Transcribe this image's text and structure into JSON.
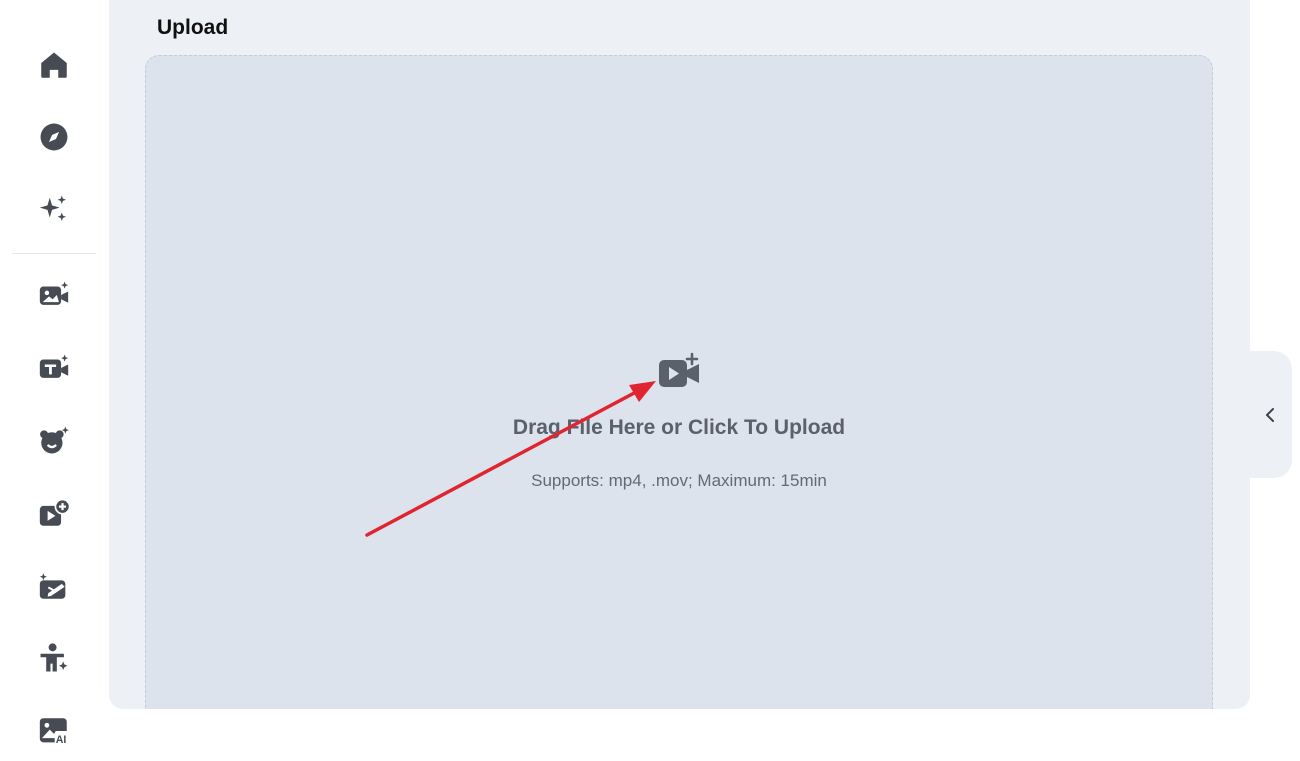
{
  "sidebar": {
    "items": [
      {
        "name": "home-icon"
      },
      {
        "name": "compass-icon"
      },
      {
        "name": "sparkles-icon"
      },
      {
        "name": "image-to-video-icon"
      },
      {
        "name": "text-to-video-icon"
      },
      {
        "name": "avatar-icon"
      },
      {
        "name": "add-video-icon"
      },
      {
        "name": "video-edit-icon"
      },
      {
        "name": "person-magic-icon"
      },
      {
        "name": "ai-image-icon"
      }
    ]
  },
  "upload": {
    "title": "Upload",
    "main_text": "Drag File Here or Click To Upload",
    "sub_text": "Supports: mp4, .mov; Maximum: 15min",
    "icon": "video-plus-icon"
  },
  "colors": {
    "panel_bg": "#edf0f5",
    "dropzone_bg": "#dde3ec",
    "icon_color": "#5b616b",
    "annotation_arrow": "#e02530"
  }
}
